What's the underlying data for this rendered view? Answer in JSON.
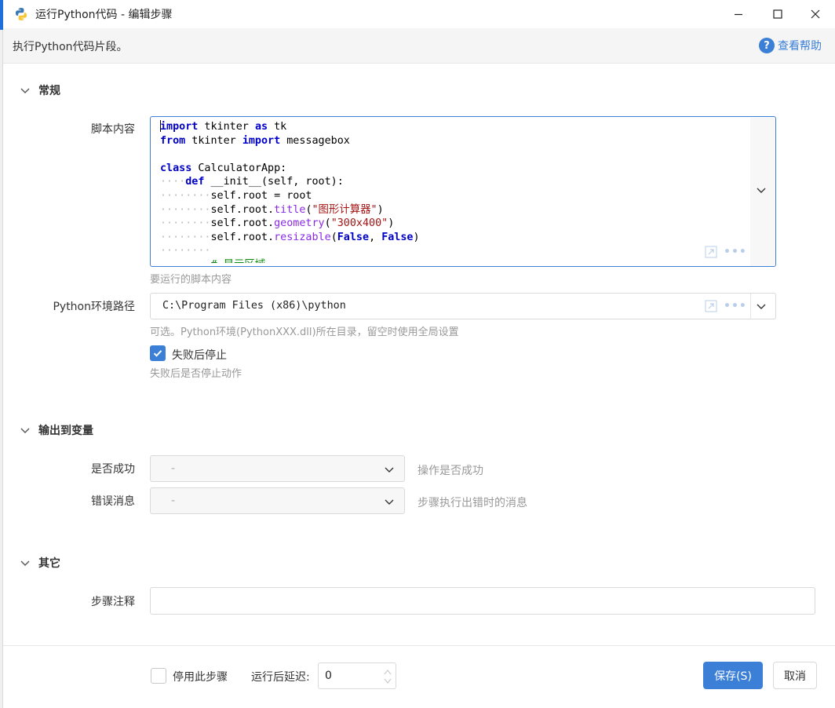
{
  "window": {
    "title": "运行Python代码  -  编辑步骤",
    "description": "执行Python代码片段。",
    "help_label": "查看帮助"
  },
  "sections": {
    "general": "常规",
    "output": "输出到变量",
    "other": "其它"
  },
  "script": {
    "label": "脚本内容",
    "hint": "要运行的脚本内容",
    "code_lines": [
      "import tkinter as tk",
      "from tkinter import messagebox",
      "",
      "class CalculatorApp:",
      "    def __init__(self, root):",
      "        self.root = root",
      "        self.root.title(\"图形计算器\")",
      "        self.root.geometry(\"300x400\")",
      "        self.root.resizable(False, False)",
      "",
      "        # 显示区域"
    ]
  },
  "python_path": {
    "label": "Python环境路径",
    "value": "C:\\Program Files (x86)\\python",
    "hint": "可选。Python环境(PythonXXX.dll)所在目录，留空时使用全局设置"
  },
  "stop_on_fail": {
    "label": "失败后停止",
    "hint": "失败后是否停止动作",
    "checked": true
  },
  "outputs": {
    "success": {
      "label": "是否成功",
      "value": "-",
      "hint": "操作是否成功"
    },
    "error": {
      "label": "错误消息",
      "value": "-",
      "hint": "步骤执行出错时的消息"
    }
  },
  "comment": {
    "label": "步骤注释",
    "value": ""
  },
  "footer": {
    "disable_label": "停用此步骤",
    "disable_checked": false,
    "delay_label": "运行后延迟:",
    "delay_value": "0",
    "save_label": "保存(S)",
    "cancel_label": "取消"
  },
  "colors": {
    "accent": "#3b7fd6",
    "keyword": "#0000c8",
    "method": "#8a2be2",
    "string": "#a31515"
  }
}
